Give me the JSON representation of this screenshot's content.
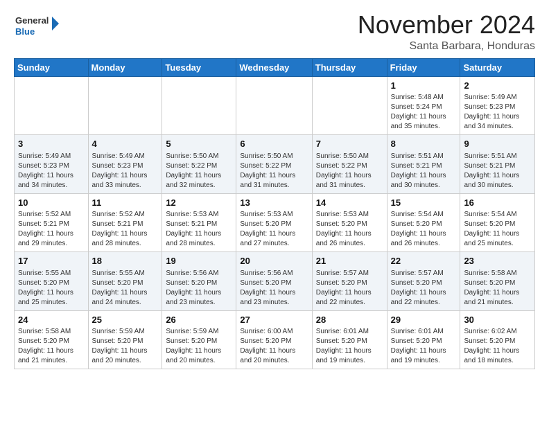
{
  "header": {
    "logo_line1": "General",
    "logo_line2": "Blue",
    "month_title": "November 2024",
    "location": "Santa Barbara, Honduras"
  },
  "weekdays": [
    "Sunday",
    "Monday",
    "Tuesday",
    "Wednesday",
    "Thursday",
    "Friday",
    "Saturday"
  ],
  "weeks": [
    [
      {
        "day": "",
        "info": ""
      },
      {
        "day": "",
        "info": ""
      },
      {
        "day": "",
        "info": ""
      },
      {
        "day": "",
        "info": ""
      },
      {
        "day": "",
        "info": ""
      },
      {
        "day": "1",
        "info": "Sunrise: 5:48 AM\nSunset: 5:24 PM\nDaylight: 11 hours\nand 35 minutes."
      },
      {
        "day": "2",
        "info": "Sunrise: 5:49 AM\nSunset: 5:23 PM\nDaylight: 11 hours\nand 34 minutes."
      }
    ],
    [
      {
        "day": "3",
        "info": "Sunrise: 5:49 AM\nSunset: 5:23 PM\nDaylight: 11 hours\nand 34 minutes."
      },
      {
        "day": "4",
        "info": "Sunrise: 5:49 AM\nSunset: 5:23 PM\nDaylight: 11 hours\nand 33 minutes."
      },
      {
        "day": "5",
        "info": "Sunrise: 5:50 AM\nSunset: 5:22 PM\nDaylight: 11 hours\nand 32 minutes."
      },
      {
        "day": "6",
        "info": "Sunrise: 5:50 AM\nSunset: 5:22 PM\nDaylight: 11 hours\nand 31 minutes."
      },
      {
        "day": "7",
        "info": "Sunrise: 5:50 AM\nSunset: 5:22 PM\nDaylight: 11 hours\nand 31 minutes."
      },
      {
        "day": "8",
        "info": "Sunrise: 5:51 AM\nSunset: 5:21 PM\nDaylight: 11 hours\nand 30 minutes."
      },
      {
        "day": "9",
        "info": "Sunrise: 5:51 AM\nSunset: 5:21 PM\nDaylight: 11 hours\nand 30 minutes."
      }
    ],
    [
      {
        "day": "10",
        "info": "Sunrise: 5:52 AM\nSunset: 5:21 PM\nDaylight: 11 hours\nand 29 minutes."
      },
      {
        "day": "11",
        "info": "Sunrise: 5:52 AM\nSunset: 5:21 PM\nDaylight: 11 hours\nand 28 minutes."
      },
      {
        "day": "12",
        "info": "Sunrise: 5:53 AM\nSunset: 5:21 PM\nDaylight: 11 hours\nand 28 minutes."
      },
      {
        "day": "13",
        "info": "Sunrise: 5:53 AM\nSunset: 5:20 PM\nDaylight: 11 hours\nand 27 minutes."
      },
      {
        "day": "14",
        "info": "Sunrise: 5:53 AM\nSunset: 5:20 PM\nDaylight: 11 hours\nand 26 minutes."
      },
      {
        "day": "15",
        "info": "Sunrise: 5:54 AM\nSunset: 5:20 PM\nDaylight: 11 hours\nand 26 minutes."
      },
      {
        "day": "16",
        "info": "Sunrise: 5:54 AM\nSunset: 5:20 PM\nDaylight: 11 hours\nand 25 minutes."
      }
    ],
    [
      {
        "day": "17",
        "info": "Sunrise: 5:55 AM\nSunset: 5:20 PM\nDaylight: 11 hours\nand 25 minutes."
      },
      {
        "day": "18",
        "info": "Sunrise: 5:55 AM\nSunset: 5:20 PM\nDaylight: 11 hours\nand 24 minutes."
      },
      {
        "day": "19",
        "info": "Sunrise: 5:56 AM\nSunset: 5:20 PM\nDaylight: 11 hours\nand 23 minutes."
      },
      {
        "day": "20",
        "info": "Sunrise: 5:56 AM\nSunset: 5:20 PM\nDaylight: 11 hours\nand 23 minutes."
      },
      {
        "day": "21",
        "info": "Sunrise: 5:57 AM\nSunset: 5:20 PM\nDaylight: 11 hours\nand 22 minutes."
      },
      {
        "day": "22",
        "info": "Sunrise: 5:57 AM\nSunset: 5:20 PM\nDaylight: 11 hours\nand 22 minutes."
      },
      {
        "day": "23",
        "info": "Sunrise: 5:58 AM\nSunset: 5:20 PM\nDaylight: 11 hours\nand 21 minutes."
      }
    ],
    [
      {
        "day": "24",
        "info": "Sunrise: 5:58 AM\nSunset: 5:20 PM\nDaylight: 11 hours\nand 21 minutes."
      },
      {
        "day": "25",
        "info": "Sunrise: 5:59 AM\nSunset: 5:20 PM\nDaylight: 11 hours\nand 20 minutes."
      },
      {
        "day": "26",
        "info": "Sunrise: 5:59 AM\nSunset: 5:20 PM\nDaylight: 11 hours\nand 20 minutes."
      },
      {
        "day": "27",
        "info": "Sunrise: 6:00 AM\nSunset: 5:20 PM\nDaylight: 11 hours\nand 20 minutes."
      },
      {
        "day": "28",
        "info": "Sunrise: 6:01 AM\nSunset: 5:20 PM\nDaylight: 11 hours\nand 19 minutes."
      },
      {
        "day": "29",
        "info": "Sunrise: 6:01 AM\nSunset: 5:20 PM\nDaylight: 11 hours\nand 19 minutes."
      },
      {
        "day": "30",
        "info": "Sunrise: 6:02 AM\nSunset: 5:20 PM\nDaylight: 11 hours\nand 18 minutes."
      }
    ]
  ]
}
